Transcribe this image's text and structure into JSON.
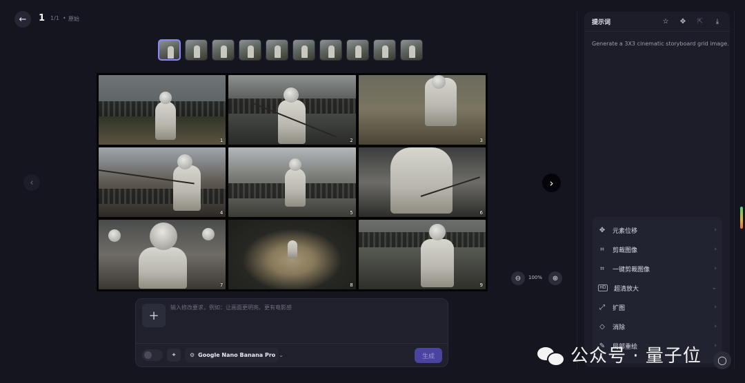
{
  "nav": {
    "back_icon": "arrow-left-icon",
    "page_number": "1",
    "page_count": "1/1",
    "separator": "•",
    "mode_label": "原始"
  },
  "thumbnails": [
    {
      "label": "thumb-1",
      "active": true
    },
    {
      "label": "thumb-2",
      "active": false
    },
    {
      "label": "thumb-3",
      "active": false
    },
    {
      "label": "thumb-4",
      "active": false
    },
    {
      "label": "thumb-5",
      "active": false
    },
    {
      "label": "thumb-6",
      "active": false
    },
    {
      "label": "thumb-7",
      "active": false
    },
    {
      "label": "thumb-8",
      "active": false
    },
    {
      "label": "thumb-9",
      "active": false
    },
    {
      "label": "thumb-10",
      "active": false
    }
  ],
  "storyboard": {
    "panels": [
      "1",
      "2",
      "3",
      "4",
      "5",
      "6",
      "7",
      "8",
      "9"
    ]
  },
  "viewer": {
    "prev_icon": "chevron-left-icon",
    "next_icon": "chevron-right-icon",
    "zoom_level": "100%",
    "zoom_out_icon": "zoom-out-icon",
    "zoom_in_icon": "zoom-in-icon"
  },
  "editor": {
    "add_icon": "+",
    "placeholder": "输入修改要求，例如：让画面更明亮、更有电影感",
    "model_name": "Google Nano Banana Pro",
    "generate_label": "生成"
  },
  "right_panel": {
    "title": "提示词",
    "prompt": "Generate a 3X3 cinematic storyboard grid image.",
    "icons": [
      "star-icon",
      "move-icon",
      "share-icon",
      "download-icon"
    ],
    "tools": [
      {
        "label": "元素位移",
        "icon": "move-icon",
        "chevron": "›"
      },
      {
        "label": "剪裁图像",
        "icon": "crop-icon",
        "chevron": "›"
      },
      {
        "label": "一键剪裁图像",
        "icon": "crop-icon",
        "chevron": "›"
      },
      {
        "label": "超清放大",
        "icon": "hd-icon",
        "chevron": "⌄"
      },
      {
        "label": "扩图",
        "icon": "expand-icon",
        "chevron": "›"
      },
      {
        "label": "消除",
        "icon": "eraser-icon",
        "chevron": "›"
      },
      {
        "label": "局部重绘",
        "icon": "brush-icon",
        "chevron": "›"
      }
    ]
  },
  "watermark": {
    "text": "公众号 · 量子位"
  },
  "colors": {
    "background": "#14151f",
    "panel": "#1c1d28",
    "accent": "#4a43a0",
    "active_thumb": "#8a86ff"
  }
}
